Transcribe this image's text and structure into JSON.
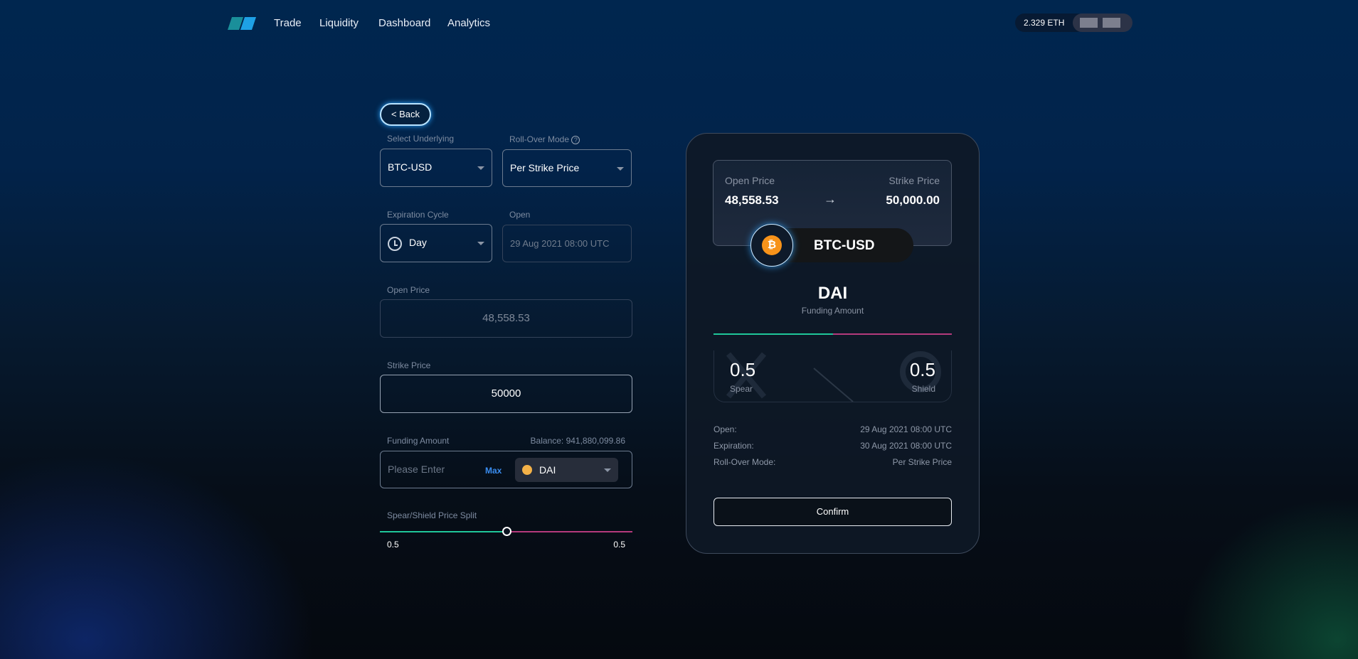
{
  "nav": {
    "items": [
      "Trade",
      "Liquidity",
      "Dashboard",
      "Analytics"
    ],
    "balance": "2.329 ETH"
  },
  "form": {
    "back": "< Back",
    "underlying_label": "Select Underlying",
    "underlying": "BTC-USD",
    "rollover_label": "Roll-Over Mode",
    "rollover": "Per Strike Price",
    "expiration_label": "Expiration Cycle",
    "expiration": "Day",
    "open_label": "Open",
    "open": "29 Aug 2021 08:00 UTC",
    "open_price_label": "Open Price",
    "open_price": "48,558.53",
    "strike_label": "Strike Price",
    "strike": "50000",
    "funding_label": "Funding Amount",
    "balance": "Balance: 941,880,099.86",
    "funding_placeholder": "Please Enter",
    "max": "Max",
    "token": "DAI",
    "split_label": "Spear/Shield Price Split",
    "split_left": "0.5",
    "split_right": "0.5",
    "split_value": 0.5
  },
  "summary": {
    "open_price_label": "Open Price",
    "open_price": "48,558.53",
    "strike_label": "Strike Price",
    "strike": "50,000.00",
    "arrow": "→",
    "pair": "BTC-USD",
    "token": "DAI",
    "funding_label": "Funding Amount",
    "spear_value": "0.5",
    "spear_label": "Spear",
    "shield_value": "0.5",
    "shield_label": "Shield",
    "rows": [
      {
        "k": "Open:",
        "v": "29 Aug 2021 08:00 UTC"
      },
      {
        "k": "Expiration:",
        "v": "30 Aug 2021 08:00 UTC"
      },
      {
        "k": "Roll-Over Mode:",
        "v": "Per Strike Price"
      }
    ],
    "confirm": "Confirm"
  },
  "colors": {
    "spear": "#1fc79a",
    "shield": "#b43a7c",
    "btc": "#f7931a"
  }
}
